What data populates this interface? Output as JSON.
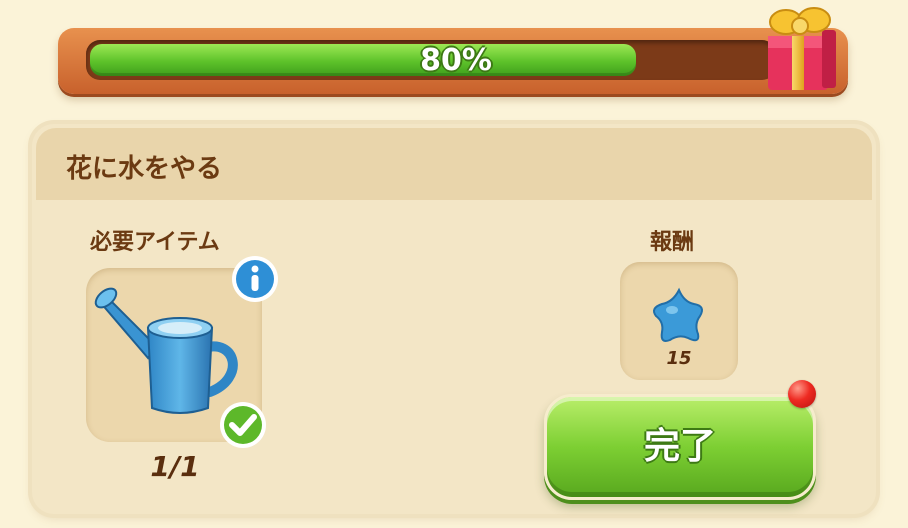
{
  "progress": {
    "percent_label": "80%",
    "value": 0.8,
    "fill_color": "#5dc22a"
  },
  "gift_box": {
    "icon": "gift-box-icon"
  },
  "quest": {
    "title": "花に水をやる",
    "required_items_label": "必要アイテム",
    "item_icon": "watering-can-icon",
    "item_count": "1/1",
    "info_icon": "info-icon",
    "check_icon": "checkmark-icon",
    "reward_label": "報酬",
    "reward_icon": "blue-star-icon",
    "reward_amount": "15",
    "complete_label": "完了"
  },
  "colors": {
    "background": "#fbf3d8",
    "panel": "#f3e6c6",
    "button_green": "#7dcf33",
    "notification": "#ee2a22"
  }
}
